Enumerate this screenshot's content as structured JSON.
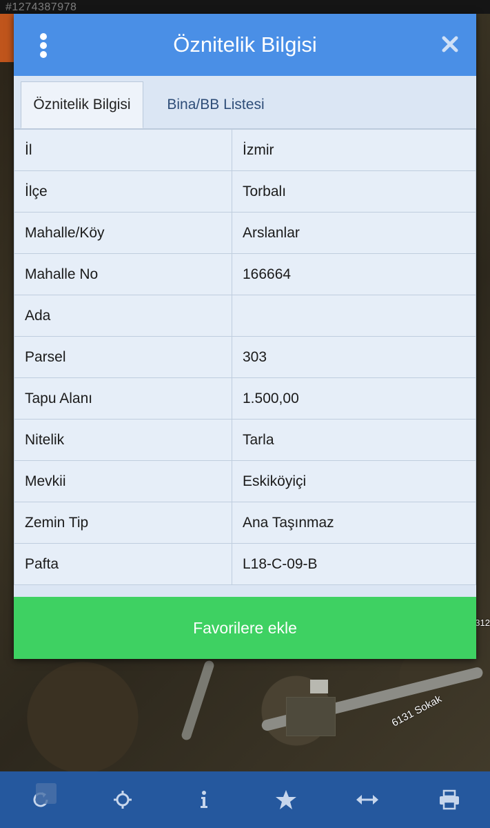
{
  "listing_id": "#1274387978",
  "dialog": {
    "title": "Öznitelik Bilgisi",
    "tabs": [
      {
        "label": "Öznitelik Bilgisi",
        "active": true
      },
      {
        "label": "Bina/BB Listesi",
        "active": false
      }
    ],
    "rows": [
      {
        "key": "İl",
        "value": "İzmir"
      },
      {
        "key": "İlçe",
        "value": "Torbalı"
      },
      {
        "key": "Mahalle/Köy",
        "value": "Arslanlar"
      },
      {
        "key": "Mahalle No",
        "value": "166664"
      },
      {
        "key": "Ada",
        "value": ""
      },
      {
        "key": "Parsel",
        "value": "303"
      },
      {
        "key": "Tapu Alanı",
        "value": "1.500,00"
      },
      {
        "key": "Nitelik",
        "value": "Tarla"
      },
      {
        "key": "Mevkii",
        "value": "Eskiköyiçi"
      },
      {
        "key": "Zemin Tip",
        "value": "Ana Taşınmaz"
      },
      {
        "key": "Pafta",
        "value": "L18-C-09-B"
      }
    ],
    "favorite_button_label": "Favorilere ekle"
  },
  "map": {
    "road_label": "6131 Sokak",
    "side_number": "312"
  },
  "toolbar": {
    "icons": [
      "refresh-icon",
      "crosshair-icon",
      "info-icon",
      "star-icon",
      "measure-icon",
      "print-icon"
    ]
  },
  "colors": {
    "header": "#4a8fe6",
    "favorite_button": "#3ed162",
    "toolbar": "#25589e"
  }
}
